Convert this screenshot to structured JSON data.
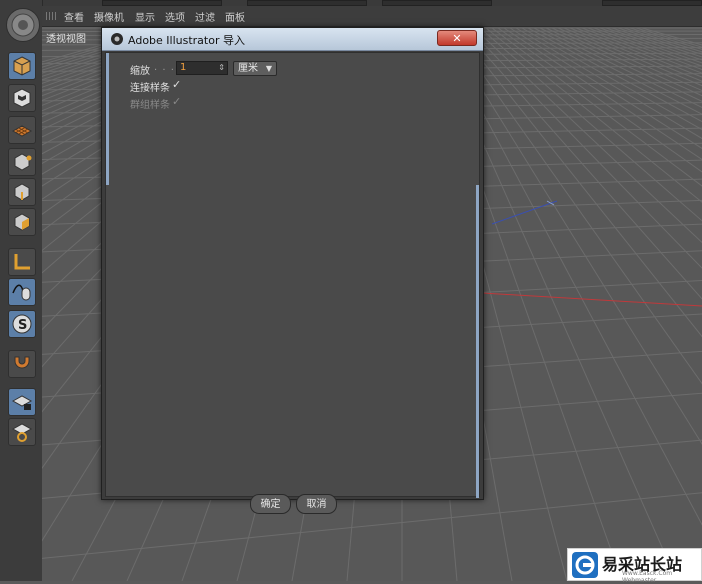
{
  "viewport": {
    "menu": [
      "查看",
      "摄像机",
      "显示",
      "选项",
      "过滤",
      "面板"
    ],
    "label": "透视视图"
  },
  "dialog": {
    "title": "Adobe Illustrator 导入",
    "close_label": "✕",
    "scale": {
      "label": "缩放",
      "dots": ". . . .",
      "value": "1",
      "unit": "厘米"
    },
    "connect_splines": {
      "label": "连接样条",
      "checked": true
    },
    "group_splines": {
      "label": "群组样条",
      "checked": true,
      "disabled": true
    },
    "ok_label": "确定",
    "cancel_label": "取消"
  },
  "watermark": {
    "text": "易采站长站",
    "url": "Www.Easck.Com Webmaster"
  },
  "colors": {
    "accent_blue": "#5c7fa8",
    "axis_red": "#c0393b",
    "axis_blue": "#3a4fb0"
  }
}
